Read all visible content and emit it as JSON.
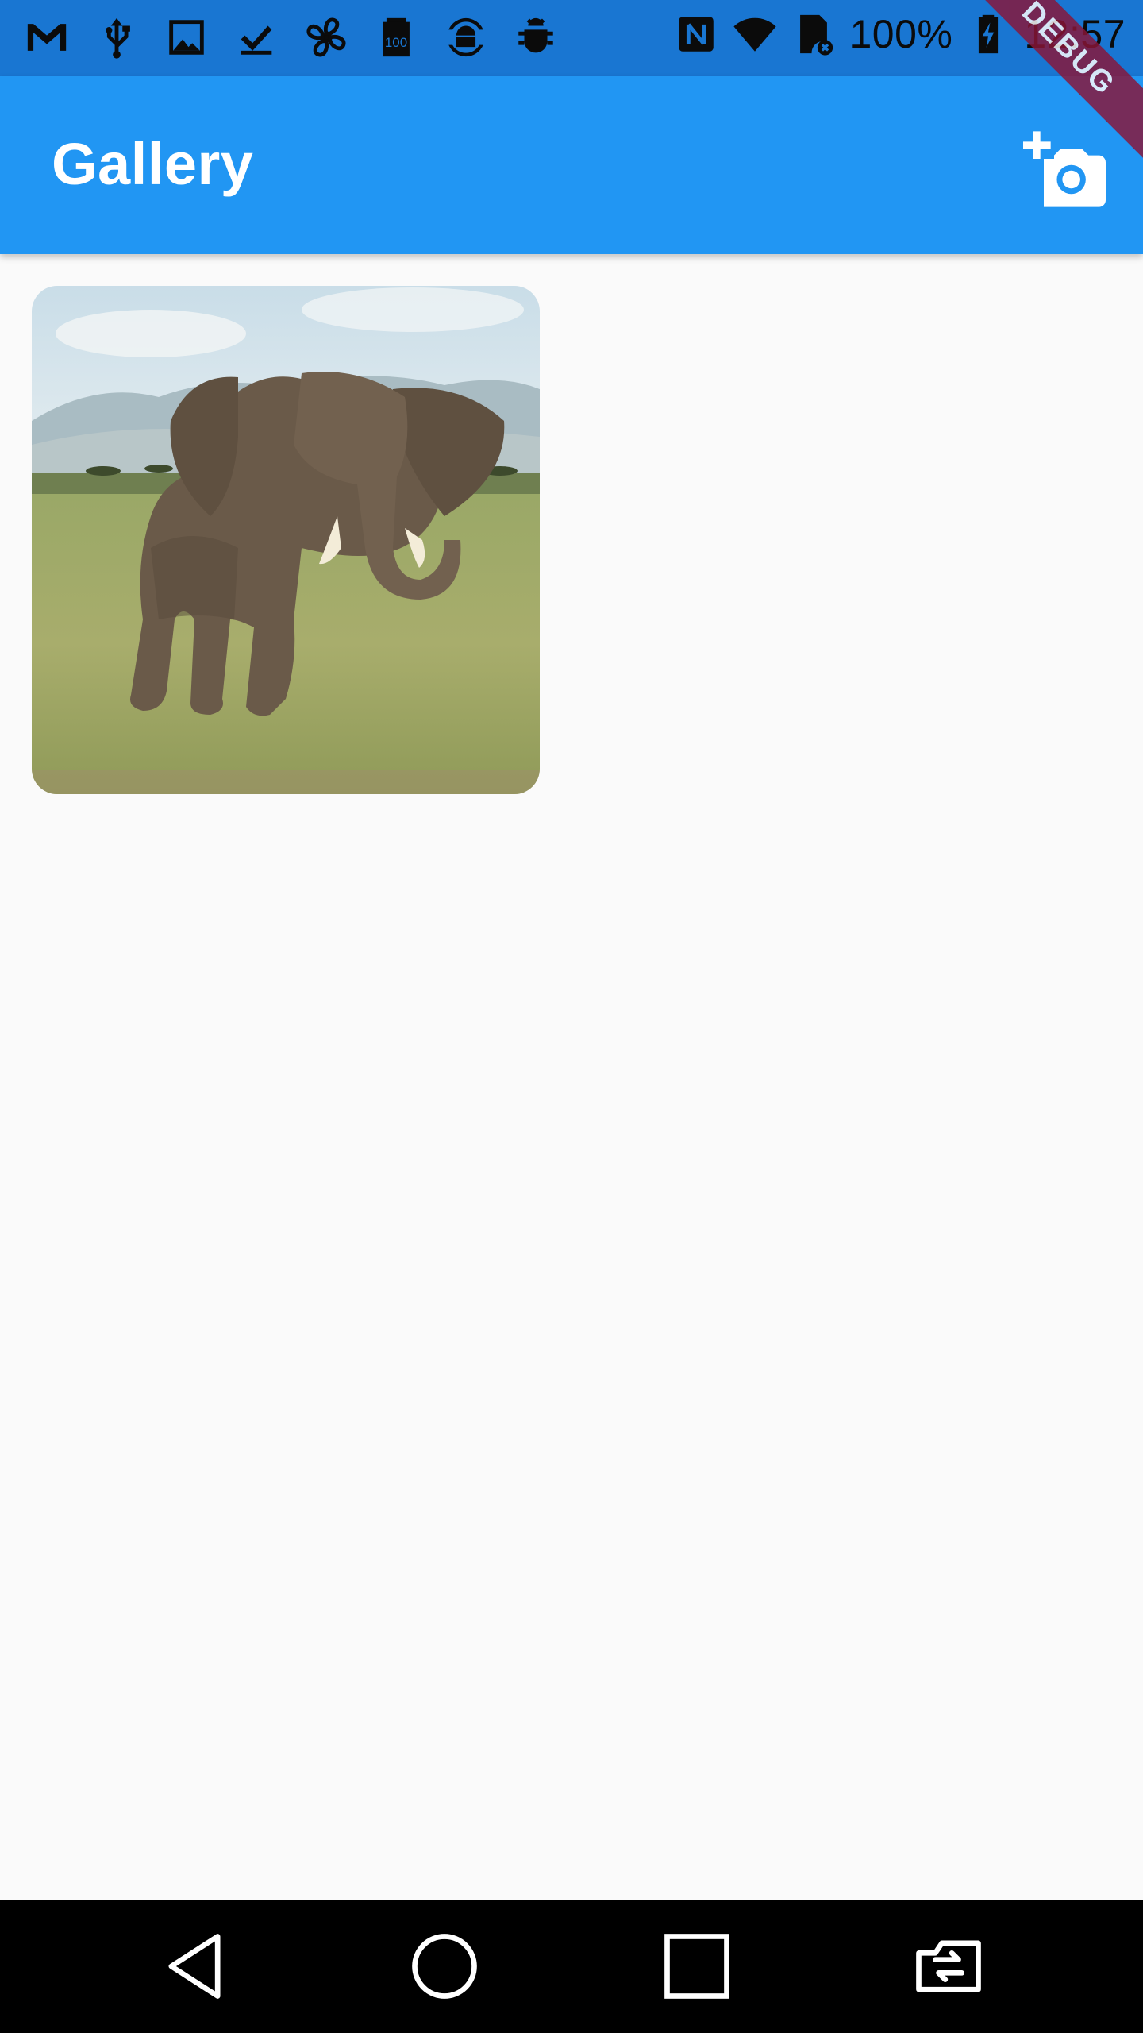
{
  "status_bar": {
    "battery_text": "100%",
    "time": "12:57",
    "left_icons": [
      "gmail-icon",
      "usb-icon",
      "image-icon",
      "download-done-icon",
      "fan-icon",
      "battery-100-icon",
      "android-sync-icon",
      "bug-icon"
    ],
    "right_icons": [
      "nfc-icon",
      "wifi-icon",
      "sim-error-icon",
      "battery-charging-icon"
    ]
  },
  "app_bar": {
    "title": "Gallery",
    "action_icon": "add-a-photo-icon",
    "background_color": "#2196f3"
  },
  "debug_banner": {
    "label": "DEBUG",
    "color": "#8a1538"
  },
  "gallery": {
    "items": [
      {
        "subject": "elephant-photo"
      }
    ]
  },
  "nav_bar": {
    "buttons": [
      "back-icon",
      "home-icon",
      "recents-icon",
      "rotate-icon"
    ]
  }
}
